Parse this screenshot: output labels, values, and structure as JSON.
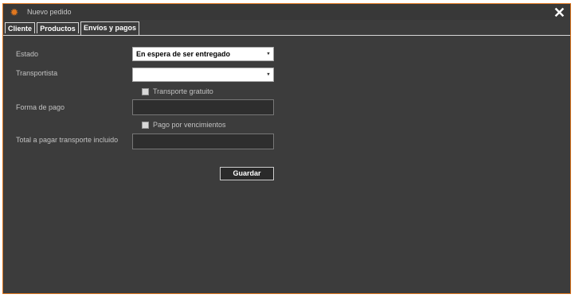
{
  "window": {
    "title": "Nuevo pedido",
    "close_glyph": "✕",
    "icon_glyph": "✹",
    "accent_color": "#e0771f",
    "title_icon": "sun-icon",
    "close_icon": "close-icon"
  },
  "tabs": [
    {
      "label": "Cliente",
      "active": false
    },
    {
      "label": "Productos",
      "active": false
    },
    {
      "label": "Envíos y pagos",
      "active": true
    }
  ],
  "form": {
    "estado": {
      "label": "Estado",
      "value": "En espera de ser entregado"
    },
    "transportista": {
      "label": "Transportista",
      "value": ""
    },
    "transporte_gratuito": {
      "label": "Transporte gratuito",
      "checked": false
    },
    "forma_de_pago": {
      "label": "Forma de pago",
      "value": ""
    },
    "pago_por_vencimientos": {
      "label": "Pago por vencimientos",
      "checked": false
    },
    "total_transporte": {
      "label": "Total a pagar transporte incluido",
      "value": ""
    },
    "dropdown_arrow": "▾"
  },
  "actions": {
    "save_label": "Guardar"
  }
}
